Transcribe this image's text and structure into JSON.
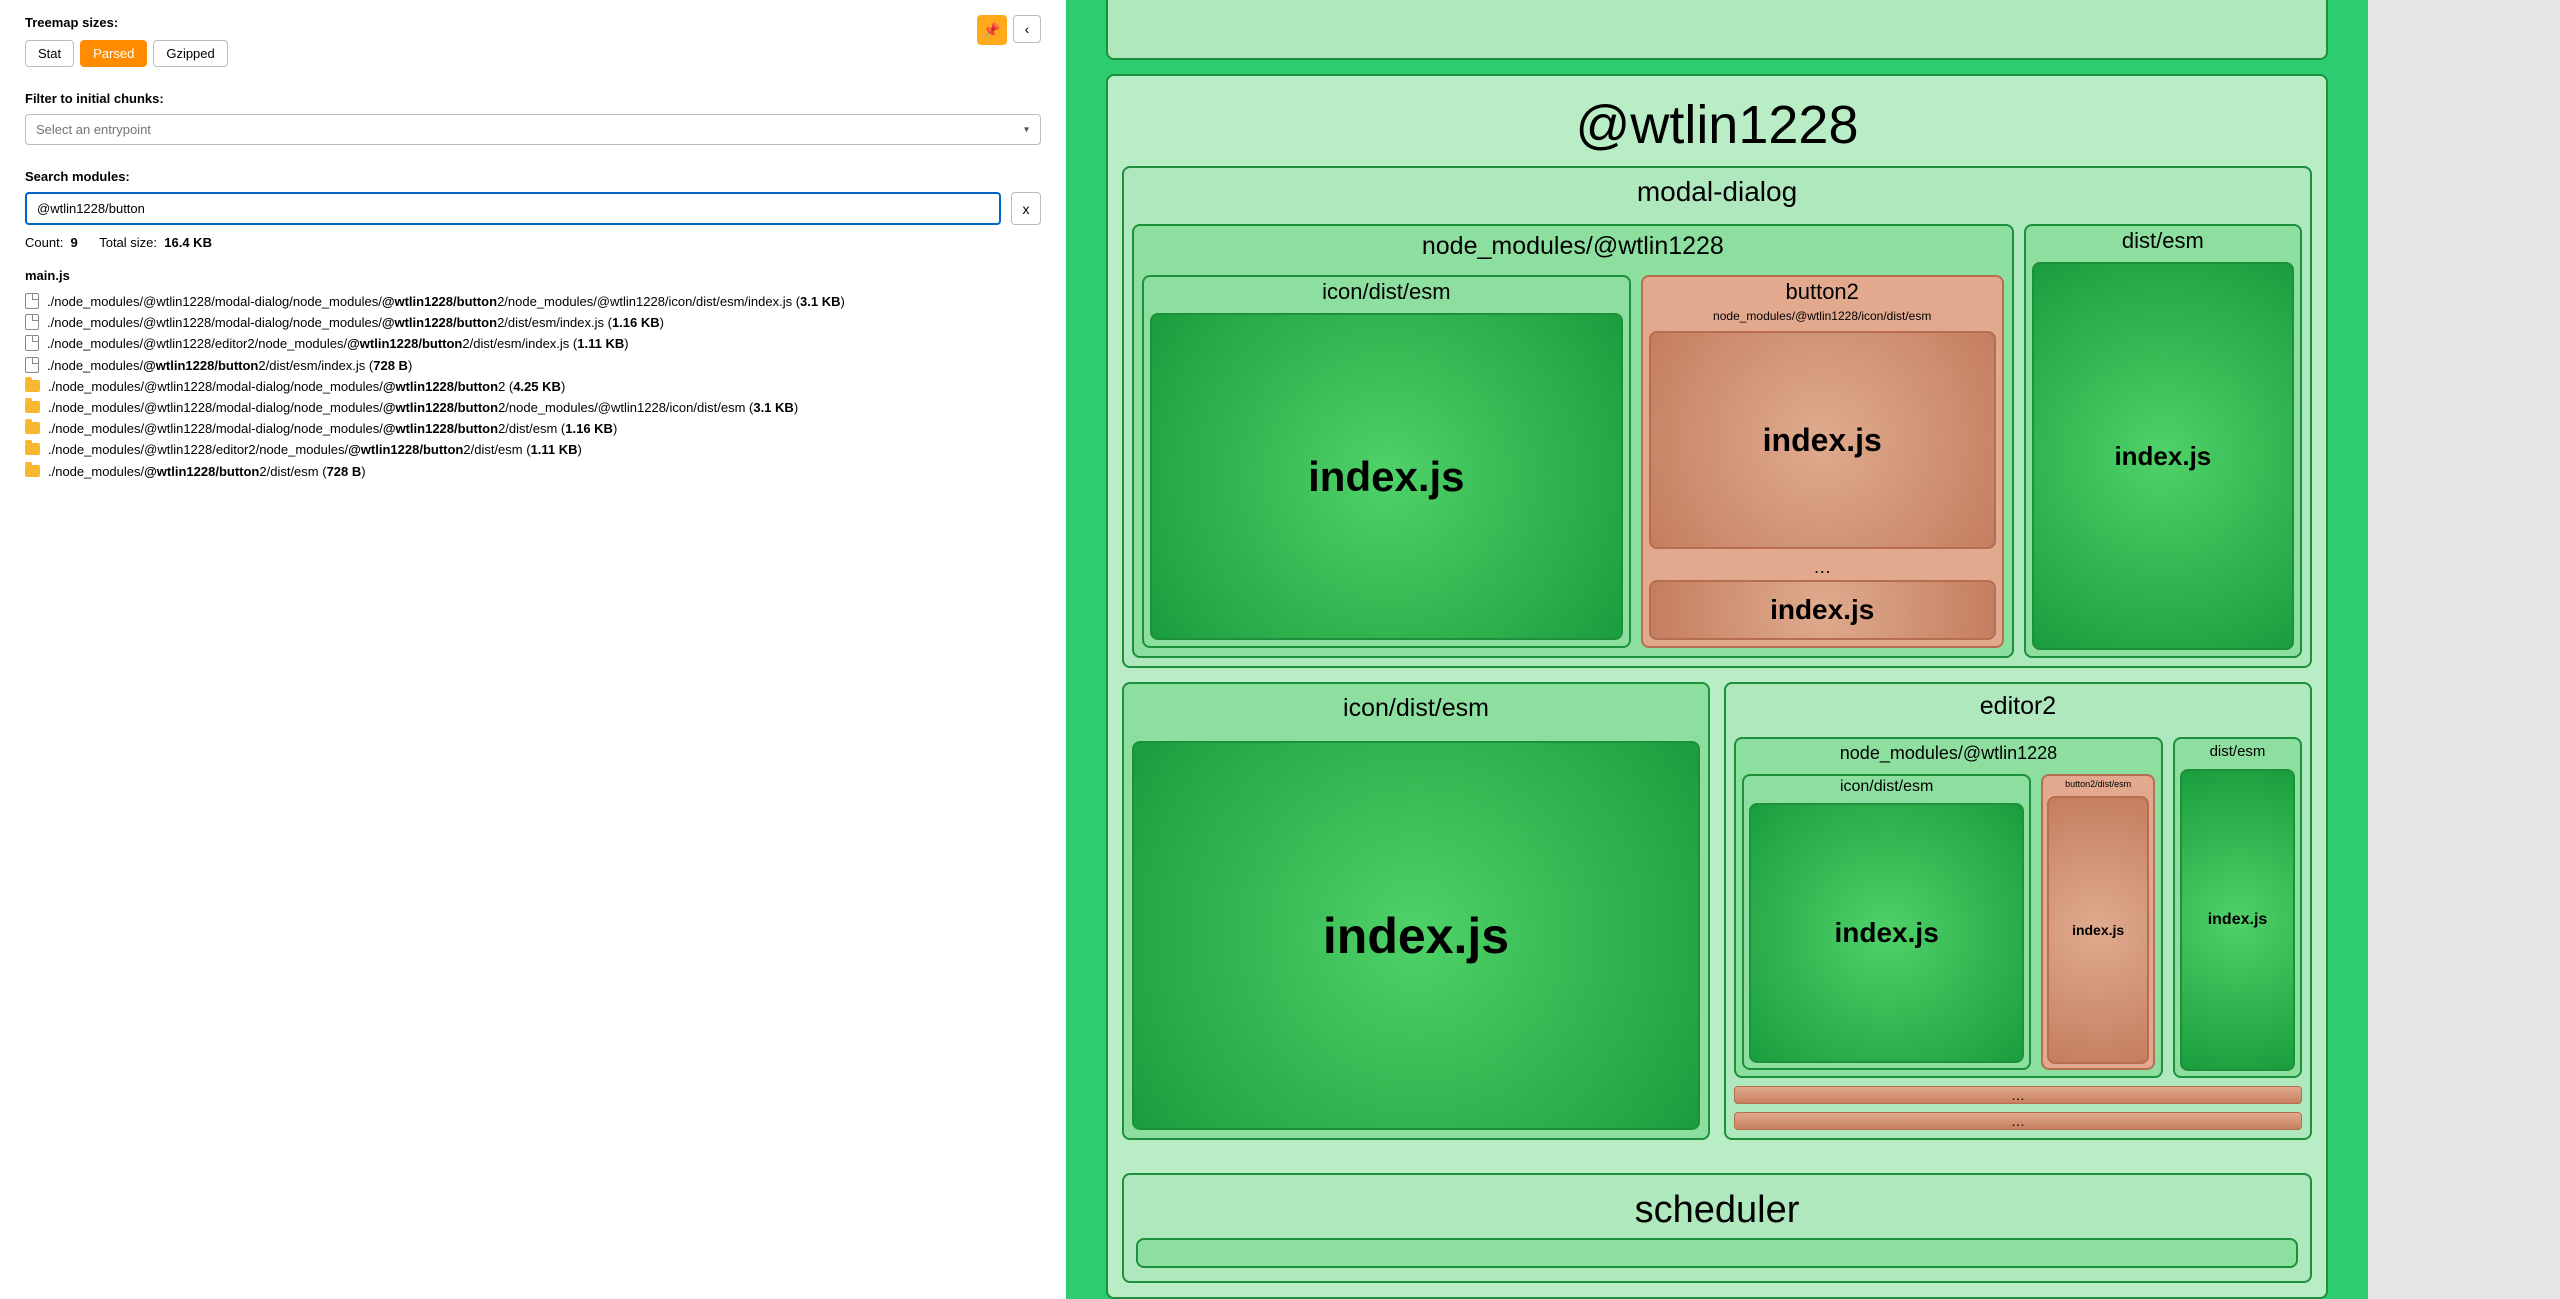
{
  "sidebar": {
    "treemap_sizes_label": "Treemap sizes:",
    "size_buttons": {
      "stat": "Stat",
      "parsed": "Parsed",
      "gzipped": "Gzipped"
    },
    "pin_icon": "📌",
    "collapse_icon": "‹",
    "filter_label": "Filter to initial chunks:",
    "entrypoint_placeholder": "Select an entrypoint",
    "search_label": "Search modules:",
    "search_value": "@wtlin1228/button",
    "clear_label": "x",
    "stats": {
      "count_label": "Count:",
      "count": "9",
      "total_label": "Total size:",
      "total": "16.4 KB"
    },
    "chunk": "main.js",
    "results": [
      {
        "type": "file",
        "pre": "./node_modules/@wtlin1228/modal-dialog/node_modules/",
        "hl": "@wtlin1228/button",
        "post": "2/node_modules/@wtlin1228/icon/dist/esm/index.js",
        "size": "3.1 KB"
      },
      {
        "type": "file",
        "pre": "./node_modules/@wtlin1228/modal-dialog/node_modules/",
        "hl": "@wtlin1228/button",
        "post": "2/dist/esm/index.js",
        "size": "1.16 KB"
      },
      {
        "type": "file",
        "pre": "./node_modules/@wtlin1228/editor2/node_modules/",
        "hl": "@wtlin1228/button",
        "post": "2/dist/esm/index.js",
        "size": "1.11 KB"
      },
      {
        "type": "file",
        "pre": "./node_modules/",
        "hl": "@wtlin1228/button",
        "post": "2/dist/esm/index.js",
        "size": "728 B"
      },
      {
        "type": "folder",
        "pre": "./node_modules/@wtlin1228/modal-dialog/node_modules/",
        "hl": "@wtlin1228/button",
        "post": "2",
        "size": "4.25 KB"
      },
      {
        "type": "folder",
        "pre": "./node_modules/@wtlin1228/modal-dialog/node_modules/",
        "hl": "@wtlin1228/button",
        "post": "2/node_modules/@wtlin1228/icon/dist/esm",
        "size": "3.1 KB"
      },
      {
        "type": "folder",
        "pre": "./node_modules/@wtlin1228/modal-dialog/node_modules/",
        "hl": "@wtlin1228/button",
        "post": "2/dist/esm",
        "size": "1.16 KB"
      },
      {
        "type": "folder",
        "pre": "./node_modules/@wtlin1228/editor2/node_modules/",
        "hl": "@wtlin1228/button",
        "post": "2/dist/esm",
        "size": "1.11 KB"
      },
      {
        "type": "folder",
        "pre": "./node_modules/",
        "hl": "@wtlin1228/button",
        "post": "2/dist/esm",
        "size": "728 B"
      }
    ]
  },
  "treemap": {
    "root": "@wtlin1228",
    "modal_dialog": {
      "label": "modal-dialog",
      "nm_label": "node_modules/@wtlin1228",
      "icon_label": "icon/dist/esm",
      "icon_file": "index.js",
      "button2_label": "button2",
      "button2_sub": "node_modules/@wtlin1228/icon/dist/esm",
      "button2_file1": "index.js",
      "button2_ellipsis": "…",
      "button2_file2": "index.js",
      "dist_label": "dist/esm",
      "dist_file": "index.js"
    },
    "icon": {
      "label": "icon/dist/esm",
      "file": "index.js"
    },
    "editor2": {
      "label": "editor2",
      "nm_label": "node_modules/@wtlin1228",
      "icon_label": "icon/dist/esm",
      "icon_file": "index.js",
      "button2_label": "button2/dist/esm",
      "button2_file": "index.js",
      "dist_label": "dist/esm",
      "dist_file": "index.js",
      "ellipsis1": "…",
      "ellipsis2": "…"
    },
    "scheduler": {
      "label": "scheduler"
    }
  }
}
